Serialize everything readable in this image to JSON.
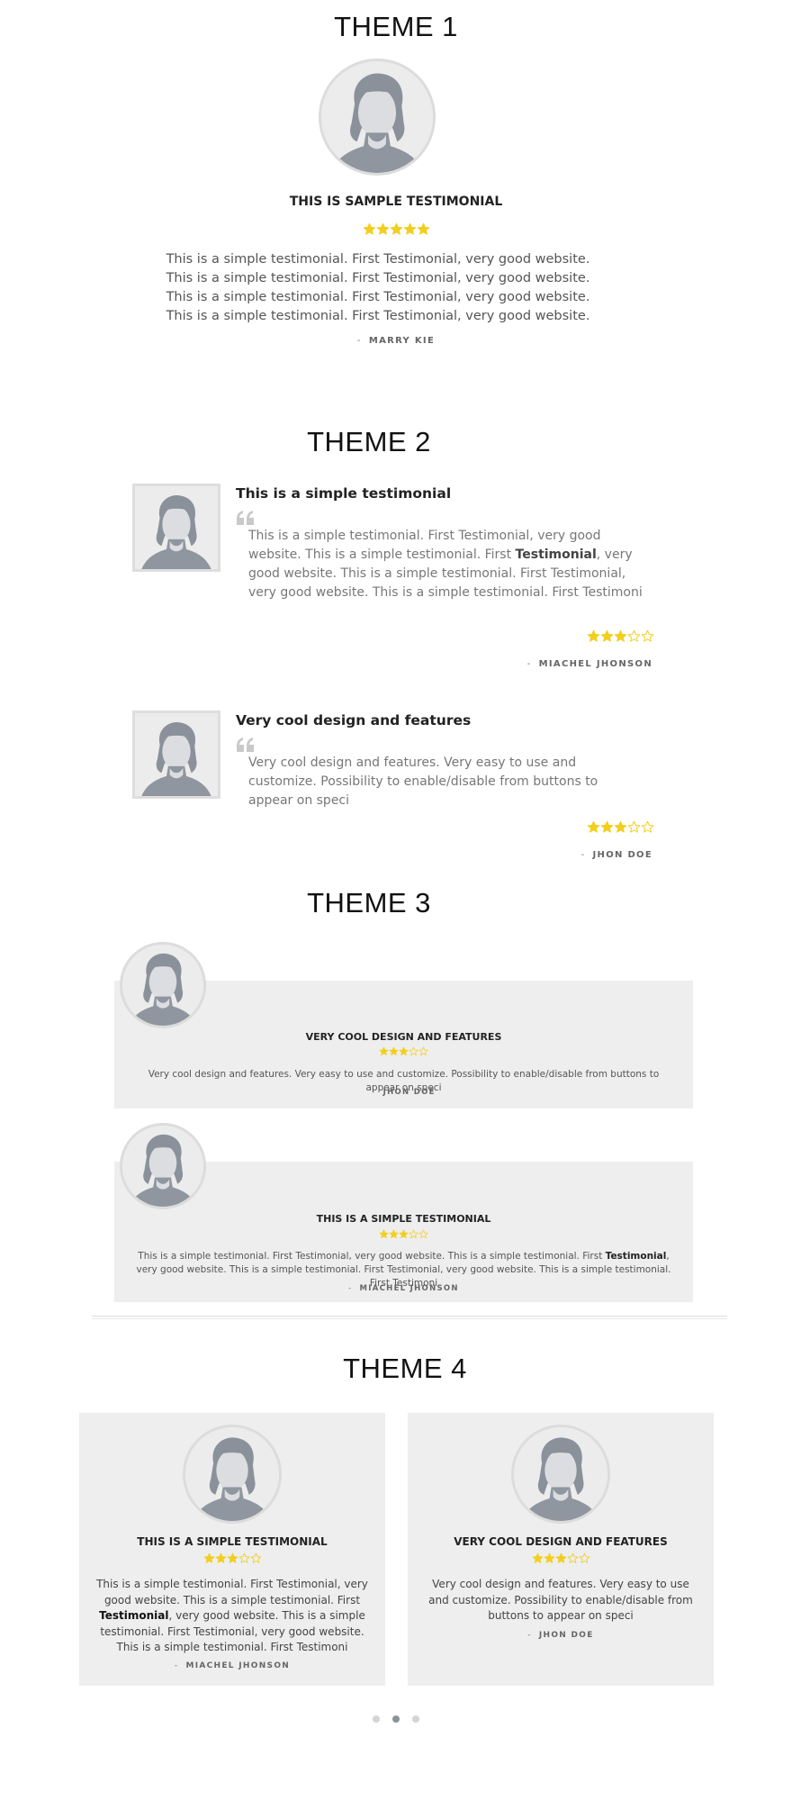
{
  "colors": {
    "star": "#f2cf1f",
    "star_empty": "#f2cf1f",
    "card_bg": "#eeeeee",
    "dot_active": "#8a9497",
    "dot": "#d4d4d4"
  },
  "theme1": {
    "heading": "THEME 1",
    "title": "THIS IS SAMPLE TESTIMONIAL",
    "rating": 5,
    "text": "This is a simple testimonial. First Testimonial, very good website. This is a simple testimonial. First Testimonial, very good website. This is a simple testimonial. First Testimonial, very good website. This is a simple testimonial. First Testimonial, very good website.",
    "author_dash": "-",
    "author": "MARRY KIE"
  },
  "theme2": {
    "heading": "THEME 2",
    "items": [
      {
        "title": "This is a simple testimonial",
        "text_pre": "This is a simple testimonial. First Testimonial, very good website. This is a simple testimonial. First ",
        "text_bold": "Testimonial",
        "text_post": ", very good website. This is a simple testimonial. First Testimonial, very good website. This is a simple testimonial. First Testimoni",
        "rating": 3,
        "author_dash": "-",
        "author": "MIACHEL JHONSON"
      },
      {
        "title": "Very cool design and features",
        "text": "Very cool design and features. Very easy to use and customize. Possibility to enable/disable from buttons to appear on speci",
        "rating": 3,
        "author_dash": "-",
        "author": "JHON DOE"
      }
    ]
  },
  "theme3": {
    "heading": "THEME 3",
    "items": [
      {
        "title": "VERY COOL DESIGN AND FEATURES",
        "rating": 3,
        "text": "Very cool design and features. Very easy to use and customize. Possibility to enable/disable from buttons to appear on speci",
        "author_dash": "-",
        "author": "JHON DOE"
      },
      {
        "title": "THIS IS A SIMPLE TESTIMONIAL",
        "rating": 3,
        "text_pre": "This is a simple testimonial. First Testimonial, very good website. This is a simple testimonial. First ",
        "text_bold": "Testimonial",
        "text_post": ", very good website. This is a simple testimonial. First Testimonial, very good website. This is a simple testimonial. First Testimoni",
        "author_dash": "-",
        "author": "MIACHEL JHONSON"
      }
    ]
  },
  "theme4": {
    "heading": "THEME 4",
    "items": [
      {
        "title": "THIS IS A SIMPLE TESTIMONIAL",
        "rating": 3,
        "text_pre": "This is a simple testimonial. First Testimonial, very good website. This is a simple testimonial. First ",
        "text_bold": "Testimonial",
        "text_post": ", very good website. This is a simple testimonial. First Testimonial, very good website. This is a simple testimonial. First Testimoni",
        "author_dash": "-",
        "author": "MIACHEL JHONSON"
      },
      {
        "title": "VERY COOL DESIGN AND FEATURES",
        "rating": 3,
        "text": "Very cool design and features. Very easy to use and customize. Possibility to enable/disable from buttons to appear on speci",
        "author_dash": "-",
        "author": "JHON DOE"
      }
    ],
    "pagination": {
      "pages": 3,
      "active": 2
    }
  },
  "icons": {
    "avatar": "person-placeholder-icon",
    "quote": "quote-icon",
    "star": "star-icon"
  }
}
